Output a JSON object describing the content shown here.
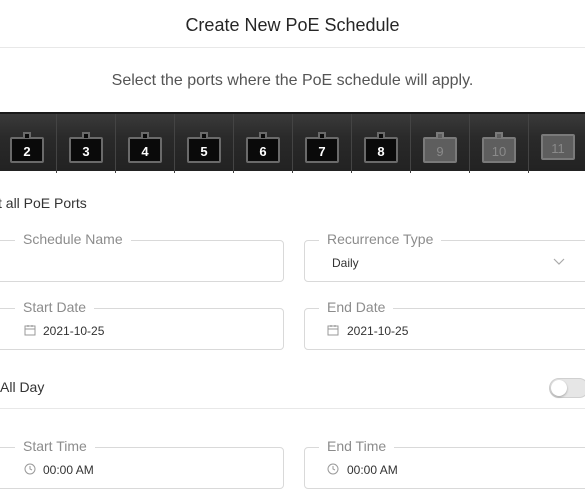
{
  "dialog": {
    "title": "Create New PoE Schedule"
  },
  "instructions": "Select the ports where the PoE schedule will apply.",
  "ports": [
    {
      "label": "2",
      "enabled": true
    },
    {
      "label": "3",
      "enabled": true
    },
    {
      "label": "4",
      "enabled": true
    },
    {
      "label": "5",
      "enabled": true
    },
    {
      "label": "6",
      "enabled": true
    },
    {
      "label": "7",
      "enabled": true
    },
    {
      "label": "8",
      "enabled": true
    },
    {
      "label": "9",
      "enabled": false
    },
    {
      "label": "10",
      "enabled": false
    },
    {
      "label": "11",
      "enabled": false
    }
  ],
  "select_all_label": "t all PoE Ports",
  "form": {
    "schedule_name": {
      "label": "Schedule Name",
      "value": ""
    },
    "recurrence_type": {
      "label": "Recurrence Type",
      "value": "Daily"
    },
    "start_date": {
      "label": "Start Date",
      "value": "2021-10-25",
      "icon": "calendar-icon"
    },
    "end_date": {
      "label": "End Date",
      "value": "2021-10-25",
      "icon": "calendar-icon"
    },
    "all_day": {
      "label": "All Day",
      "checked": false
    },
    "start_time": {
      "label": "Start Time",
      "value": "00:00 AM",
      "icon": "clock-icon"
    },
    "end_time": {
      "label": "End Time",
      "value": "00:00 AM",
      "icon": "clock-icon"
    }
  }
}
